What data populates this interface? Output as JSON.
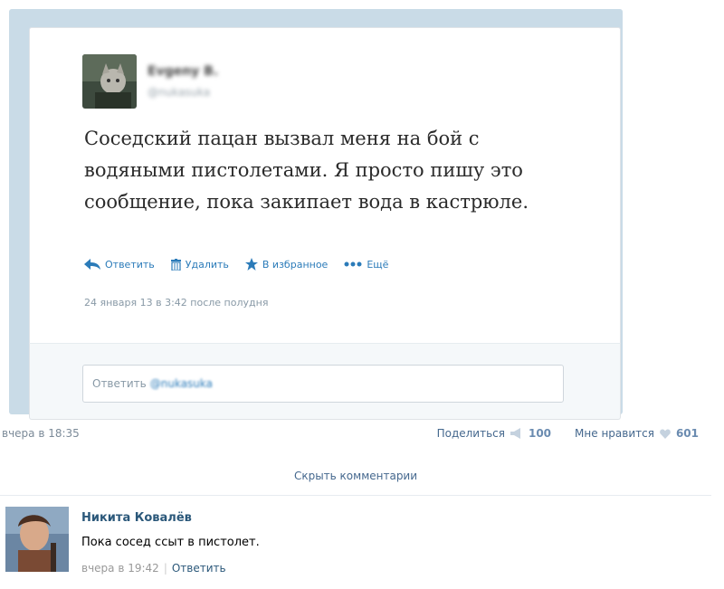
{
  "tweet": {
    "author_name": "Evgeny B.",
    "handle": "@nukasuka",
    "text": "Соседский пацан вызвал меня на бой с водяными пистолетами. Я просто пишу это сообщение, пока закипает вода в кастрюле.",
    "actions": {
      "reply": "Ответить",
      "delete": "Удалить",
      "favorite": "В избранное",
      "more": "Ещё"
    },
    "date": "24 января 13 в 3:42 после полудня",
    "reply_placeholder": "Ответить",
    "reply_mention": "@nukasuka"
  },
  "post": {
    "time": "вчера в 18:35",
    "share_label": "Поделиться",
    "share_count": "100",
    "like_label": "Мне нравится",
    "like_count": "601",
    "hide_comments": "Скрыть комментарии"
  },
  "comment": {
    "author": "Никита Ковалёв",
    "text": "Пока сосед ссыт в пистолет.",
    "time": "вчера в 19:42",
    "reply": "Ответить"
  },
  "colors": {
    "link": "#2b7bb9",
    "vk_link": "#45688e",
    "frame": "#c9dbe7"
  },
  "icons": [
    "reply-arrow-icon",
    "trash-icon",
    "star-icon",
    "more-dots-icon",
    "megaphone-icon",
    "heart-icon"
  ]
}
